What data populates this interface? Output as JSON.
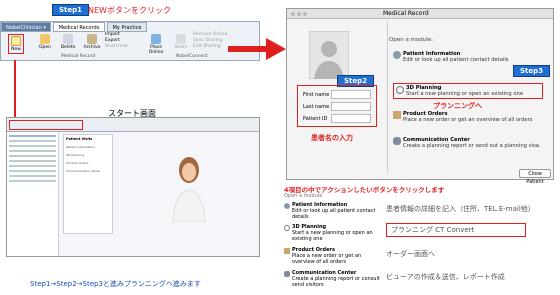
{
  "left_top": {
    "step1": "Step1",
    "caption": "NEWボタンをクリック"
  },
  "ribbon": {
    "app_tab": "NobelClinician ▾",
    "tabs": [
      "Medical Records",
      "My Practice"
    ],
    "buttons": [
      "New",
      "Open",
      "Delete",
      "Archive"
    ],
    "import": "Import",
    "export": "Export",
    "unarchive": "Unarchive",
    "place_online": "Place Online",
    "share": "Share",
    "remove_online": "Remove Online",
    "sync_sharing": "Sync Sharing",
    "edit_sharing": "Edit Sharing",
    "group1": "Medical Record",
    "group2": "NobelConnect"
  },
  "start_screen_label": "スタート画面",
  "bottom_caption": "Step1→Step2→Step3と進みプランニングへ進みます",
  "dialog": {
    "title": "Medical Record",
    "step2": "Step2",
    "step3": "Step3",
    "first_name": "First name",
    "last_name": "Last name",
    "patient_id": "Patient ID",
    "patient_input_caption": "患者名の入力",
    "open_module": "Open a module:",
    "modules": [
      {
        "title": "Patient Information",
        "desc": "Edit or look up all patient contact details"
      },
      {
        "title": "3D Planning",
        "desc": "Start a new planning or open an existing one"
      },
      {
        "title": "Product Orders",
        "desc": "Place a new order or get an overview of all orders"
      },
      {
        "title": "Communication Center",
        "desc": "Create a planning report or send out a planning visa."
      }
    ],
    "planning_caption": "プランニングへ",
    "close_button": "Close Patient"
  },
  "lower": {
    "heading": "4項目の中でアクションしたいボタンをクリックします",
    "sub": "Open a module",
    "rows": [
      {
        "title": "Patient Information",
        "desc": "Edit or look up all patient contact details",
        "jp": "患者情報の詳細を記入（住所、TEL.E-mail他）"
      },
      {
        "title": "3D Planning",
        "desc": "Start a new planning or open an existing one",
        "jp": "プランニング CT Convert"
      },
      {
        "title": "Product Orders",
        "desc": "Place a new order or get an overview of all orders",
        "jp": "オーダー画面へ"
      },
      {
        "title": "Communication Center",
        "desc": "Create a planning report or consult send visitors",
        "jp": "ビューアの作成＆送信、レポート作成"
      }
    ]
  },
  "thumbnail": {
    "header": "Patient Visits",
    "rows": [
      "Patient Information",
      "3D Planning",
      "Product Orders",
      "Communication Center"
    ]
  },
  "colors": {
    "accent_red": "#e01f1f",
    "step_blue": "#1f6fd1"
  }
}
